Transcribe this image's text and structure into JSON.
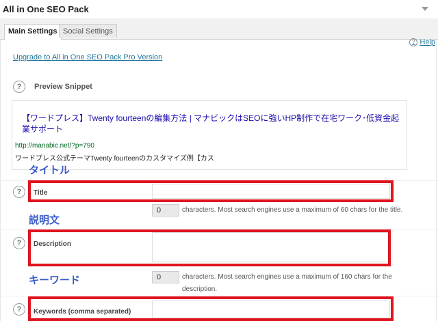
{
  "panel": {
    "title": "All in One SEO Pack"
  },
  "tabs": [
    {
      "label": "Main Settings"
    },
    {
      "label": "Social Settings"
    }
  ],
  "help_label": "Help",
  "upgrade_link": "Upgrade to All in One SEO Pack Pro Version",
  "preview": {
    "label": "Preview Snippet",
    "title": "【ワードプレス】Twenty fourteenの編集方法 | マナビックはSEOに強いHP制作で在宅ワーク･低資金起業サポート",
    "url": "http://manabic.net/?p=790",
    "description": "ワードプレス公式テーマTwenty fourteenのカスタマイズ例【カス"
  },
  "annotations": {
    "title_jp": "タイトル",
    "description_jp": "説明文",
    "keywords_jp": "キーワード"
  },
  "fields": {
    "title": {
      "label": "Title",
      "count": "0",
      "note": "characters. Most search engines use a maximum of 60 chars for the title."
    },
    "description": {
      "label": "Description",
      "count": "0",
      "note": "characters. Most search engines use a maximum of 160 chars for the description."
    },
    "keywords": {
      "label": "Keywords (comma separated)"
    }
  },
  "colors": {
    "highlight": "#e0141e",
    "annotation": "#3b5cc8",
    "link": "#21759b"
  },
  "icons": {
    "help": "question-circle-icon",
    "toggle": "caret-down-icon"
  }
}
